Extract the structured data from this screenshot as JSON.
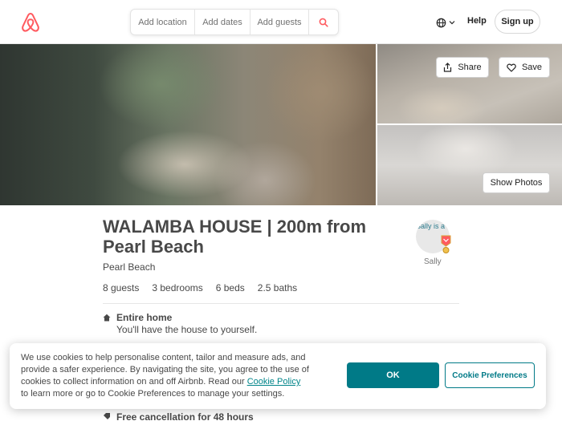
{
  "header": {
    "search": {
      "location": "Add location",
      "dates": "Add dates",
      "guests": "Add guests"
    },
    "help": "Help",
    "signup": "Sign up"
  },
  "photos": {
    "share": "Share",
    "save": "Save",
    "show_photos": "Show Photos"
  },
  "listing": {
    "title": "WALAMBA HOUSE | 200m from Pearl Beach",
    "location": "Pearl Beach",
    "stats": [
      "8 guests",
      "3 bedrooms",
      "6 beds",
      "2.5 baths"
    ],
    "host": {
      "avatar_alt": "Sally is a Superhost",
      "name": "Sally"
    },
    "features": [
      {
        "title": "Entire home",
        "description": "You'll have the house to yourself."
      },
      {
        "title": "Free cancellation for 48 hours"
      }
    ]
  },
  "cookie_banner": {
    "text_before": "We use cookies to help personalise content, tailor and measure ads, and provide a safer experience. By navigating the site, you agree to the use of cookies to collect information on and off Airbnb. Read our ",
    "link": "Cookie Policy",
    "text_after": " to learn more or go to Cookie Preferences to manage your settings.",
    "ok": "OK",
    "preferences": "Cookie Preferences"
  },
  "colors": {
    "brand": "#ff5a5f",
    "accent": "#007a87",
    "text": "#484848"
  },
  "icons": {
    "logo": "airbnb-logo",
    "search": "search-icon",
    "language": "globe-icon",
    "share": "share-icon",
    "save": "heart-icon",
    "superhost": "superhost-badge-icon",
    "home": "home-icon",
    "cancellation": "tag-icon"
  }
}
